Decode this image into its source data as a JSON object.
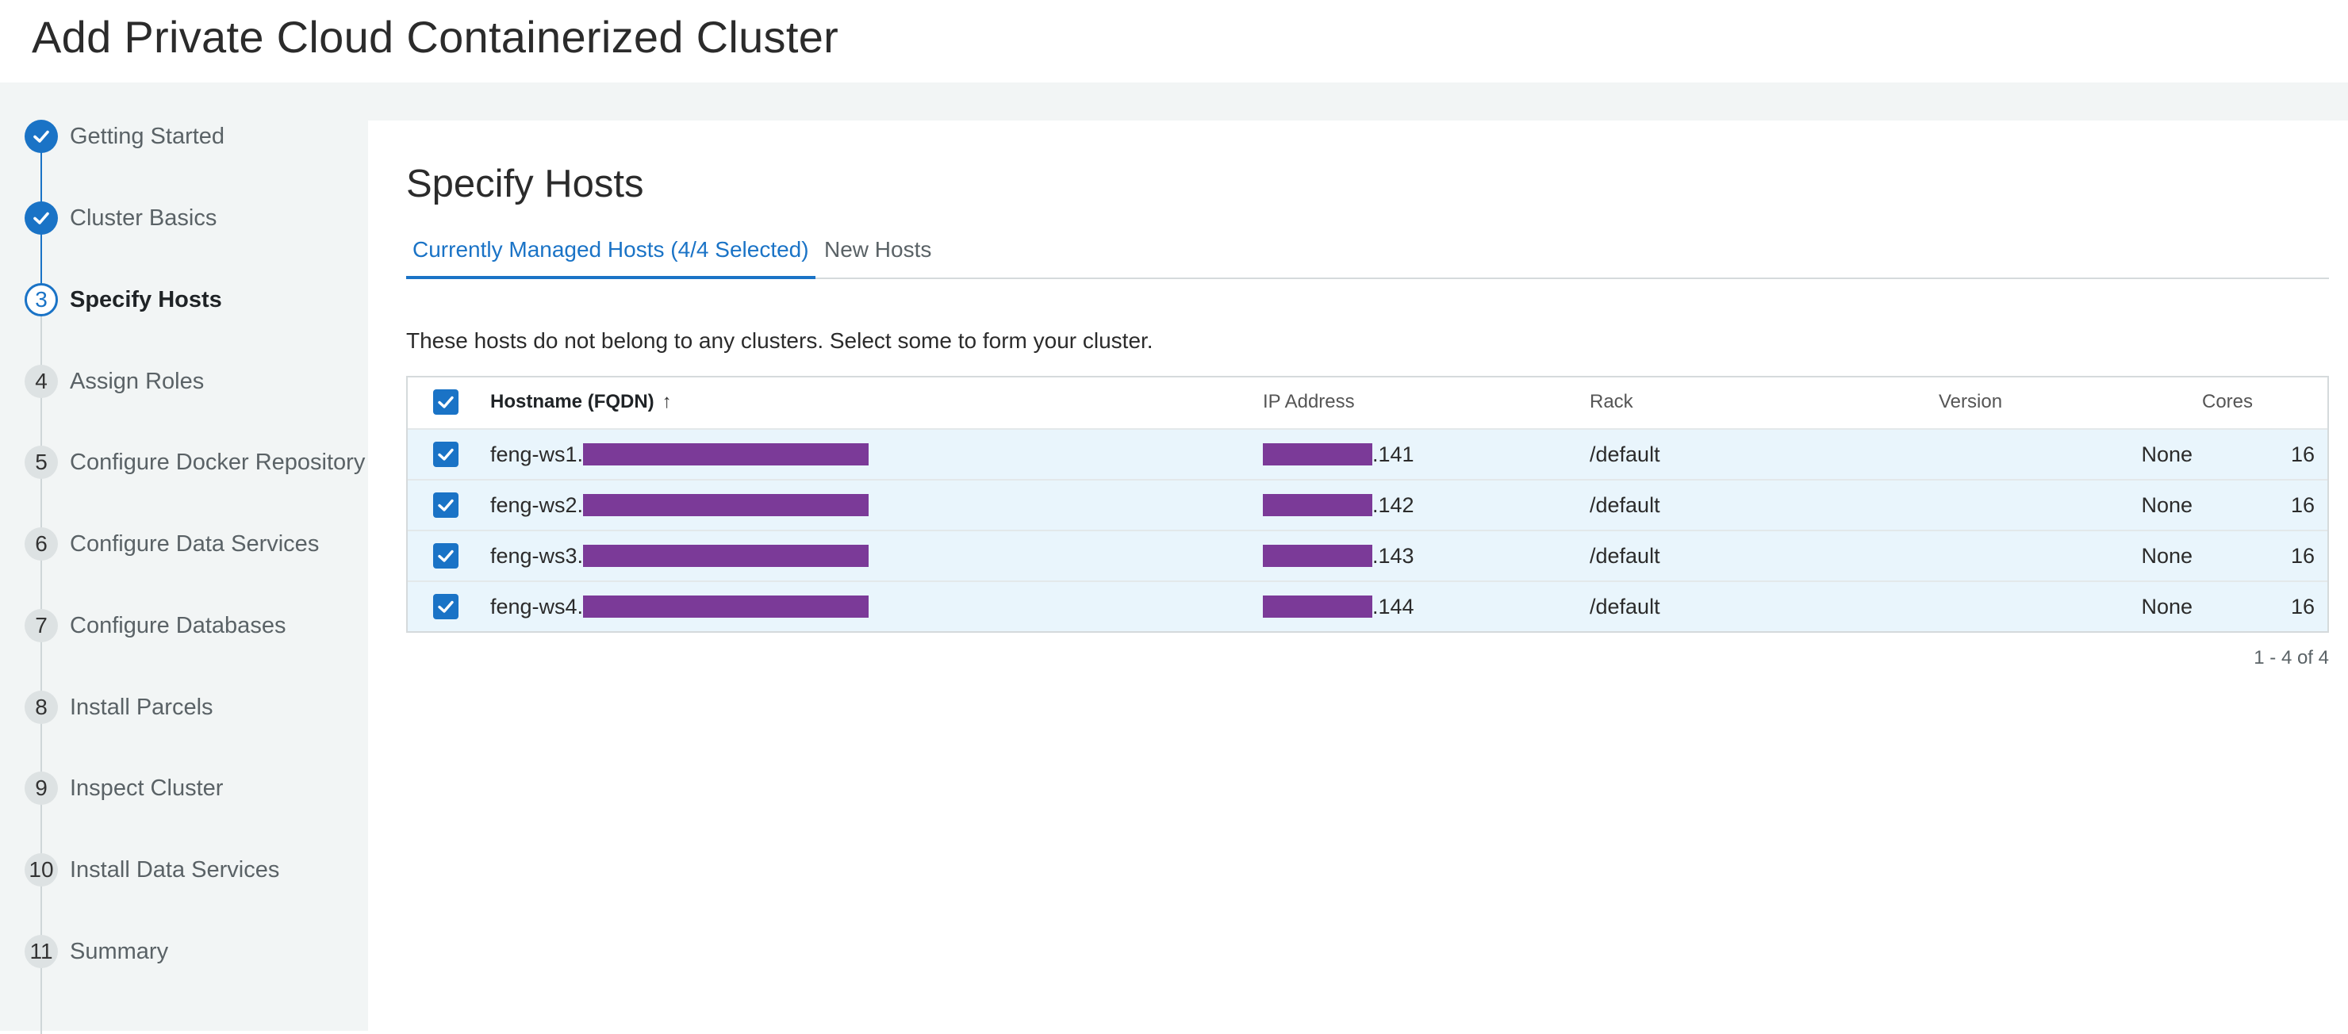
{
  "page": {
    "title": "Add Private Cloud Containerized Cluster"
  },
  "steps": [
    {
      "marker": "",
      "label": "Getting Started",
      "state": "done"
    },
    {
      "marker": "",
      "label": "Cluster Basics",
      "state": "done"
    },
    {
      "marker": "3",
      "label": "Specify Hosts",
      "state": "current"
    },
    {
      "marker": "4",
      "label": "Assign Roles",
      "state": "pending"
    },
    {
      "marker": "5",
      "label": "Configure Docker Repository",
      "state": "pending"
    },
    {
      "marker": "6",
      "label": "Configure Data Services",
      "state": "pending"
    },
    {
      "marker": "7",
      "label": "Configure Databases",
      "state": "pending"
    },
    {
      "marker": "8",
      "label": "Install Parcels",
      "state": "pending"
    },
    {
      "marker": "9",
      "label": "Inspect Cluster",
      "state": "pending"
    },
    {
      "marker": "10",
      "label": "Install Data Services",
      "state": "pending"
    },
    {
      "marker": "11",
      "label": "Summary",
      "state": "pending"
    }
  ],
  "main": {
    "title": "Specify Hosts",
    "tabs": [
      {
        "label": "Currently Managed Hosts (4/4 Selected)",
        "active": true
      },
      {
        "label": "New Hosts",
        "active": false
      }
    ],
    "intro": "These hosts do not belong to any clusters. Select some to form your cluster."
  },
  "table": {
    "columns": {
      "hostname": "Hostname (FQDN)",
      "sort_icon": "↑",
      "ip": "IP Address",
      "rack": "Rack",
      "version": "Version",
      "cores": "Cores"
    },
    "rows": [
      {
        "host_prefix": "feng-ws1.",
        "ip_suffix": ".141",
        "rack": "/default",
        "version": "None",
        "cores": "16",
        "checked": true
      },
      {
        "host_prefix": "feng-ws2.",
        "ip_suffix": ".142",
        "rack": "/default",
        "version": "None",
        "cores": "16",
        "checked": true
      },
      {
        "host_prefix": "feng-ws3.",
        "ip_suffix": ".143",
        "rack": "/default",
        "version": "None",
        "cores": "16",
        "checked": true
      },
      {
        "host_prefix": "feng-ws4.",
        "ip_suffix": ".144",
        "rack": "/default",
        "version": "None",
        "cores": "16",
        "checked": true
      }
    ],
    "pager": "1 - 4 of 4"
  },
  "colors": {
    "accent": "#1a73c6",
    "row_selected": "#e9f5fc",
    "redaction": "#7b3a98",
    "sidebar_bg": "#f2f5f5"
  }
}
